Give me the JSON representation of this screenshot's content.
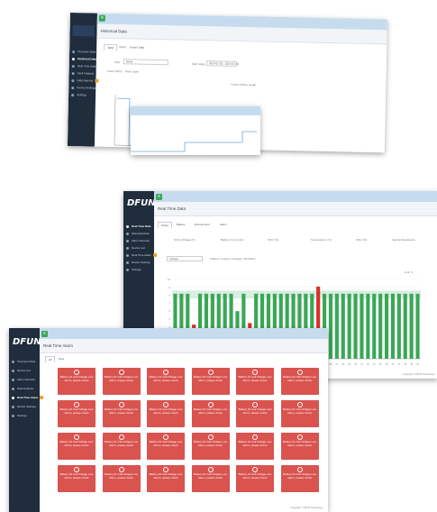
{
  "screens": {
    "history": {
      "title": "Historical Data",
      "tabs": [
        "Table",
        "Chart",
        "Export Data"
      ],
      "filter_label": "Filter",
      "filter_value": "Meter",
      "date_label": "Date range",
      "date_value": "2024-01-01 - 2024-01-31",
      "chart_title": "Power History Graph",
      "legend": [
        "Power Meter",
        "Meter Data"
      ],
      "nav": [
        "Overview Stats",
        "Historical Data",
        "Real Time Data",
        "Fault Analysis",
        "Data Reports",
        "Device Settings",
        "Settings"
      ]
    },
    "realtime": {
      "logo": "DFUN",
      "title": "Real Time Data",
      "tabs": [
        "String",
        "Battery",
        "Environment",
        "Alarm"
      ],
      "summary_labels": [
        "String Voltage (V)",
        "Battery Current (A)",
        "SOC (%)",
        "Temperature (°C)",
        "SOH (%)",
        "Internal Resistance"
      ],
      "nav": [
        "Real Time Data",
        "Historical Data",
        "Alarm Records",
        "Device List",
        "Real Time Alarm",
        "Device Settings",
        "Settings"
      ],
      "filter_value": "Voltage",
      "legend_note": "Highest / Lowest / Average / Deviation",
      "chart_note": "Unit: V",
      "footer": "Copyright © DFUN Technology"
    },
    "alarms": {
      "logo": "DFUN",
      "title": "Real Time Alarm",
      "tabs": [
        "All",
        "New"
      ],
      "tile_text": "Battery 01 Cell Voltage Low Alarm, please check",
      "nav": [
        "Overview Stats",
        "Device List",
        "Alarm Records",
        "Data Analysis",
        "Real Time Alarm",
        "Device Settings",
        "Settings"
      ],
      "footer": "Copyright © DFUN Technology"
    }
  },
  "chart_data": {
    "type": "bar",
    "categories": [
      "1",
      "2",
      "3",
      "4",
      "5",
      "6",
      "7",
      "8",
      "9",
      "10",
      "11",
      "12",
      "13",
      "14",
      "15",
      "16",
      "17",
      "18",
      "19",
      "20",
      "21",
      "22",
      "23",
      "24",
      "25",
      "26",
      "27",
      "28",
      "29",
      "30",
      "31",
      "32",
      "33",
      "34",
      "35",
      "36",
      "37",
      "38",
      "39",
      "40"
    ],
    "values": [
      8.2,
      8.2,
      8.2,
      4.3,
      8.2,
      8.2,
      8.2,
      8.2,
      8.2,
      8.2,
      6.0,
      8.2,
      4.5,
      8.2,
      8.2,
      8.2,
      8.2,
      8.2,
      8.2,
      8.2,
      8.2,
      8.2,
      8.2,
      9.1,
      8.2,
      8.2,
      8.2,
      8.2,
      8.2,
      8.2,
      8.2,
      8.2,
      8.2,
      8.2,
      8.2,
      8.2,
      8.2,
      8.2,
      8.2,
      8.2
    ],
    "alarm_indices": [
      4,
      13,
      24
    ],
    "ylim": [
      0,
      10
    ],
    "colors": {
      "normal": "#3aa757",
      "alarm": "#d9302c",
      "band": "#d8eedf"
    }
  }
}
